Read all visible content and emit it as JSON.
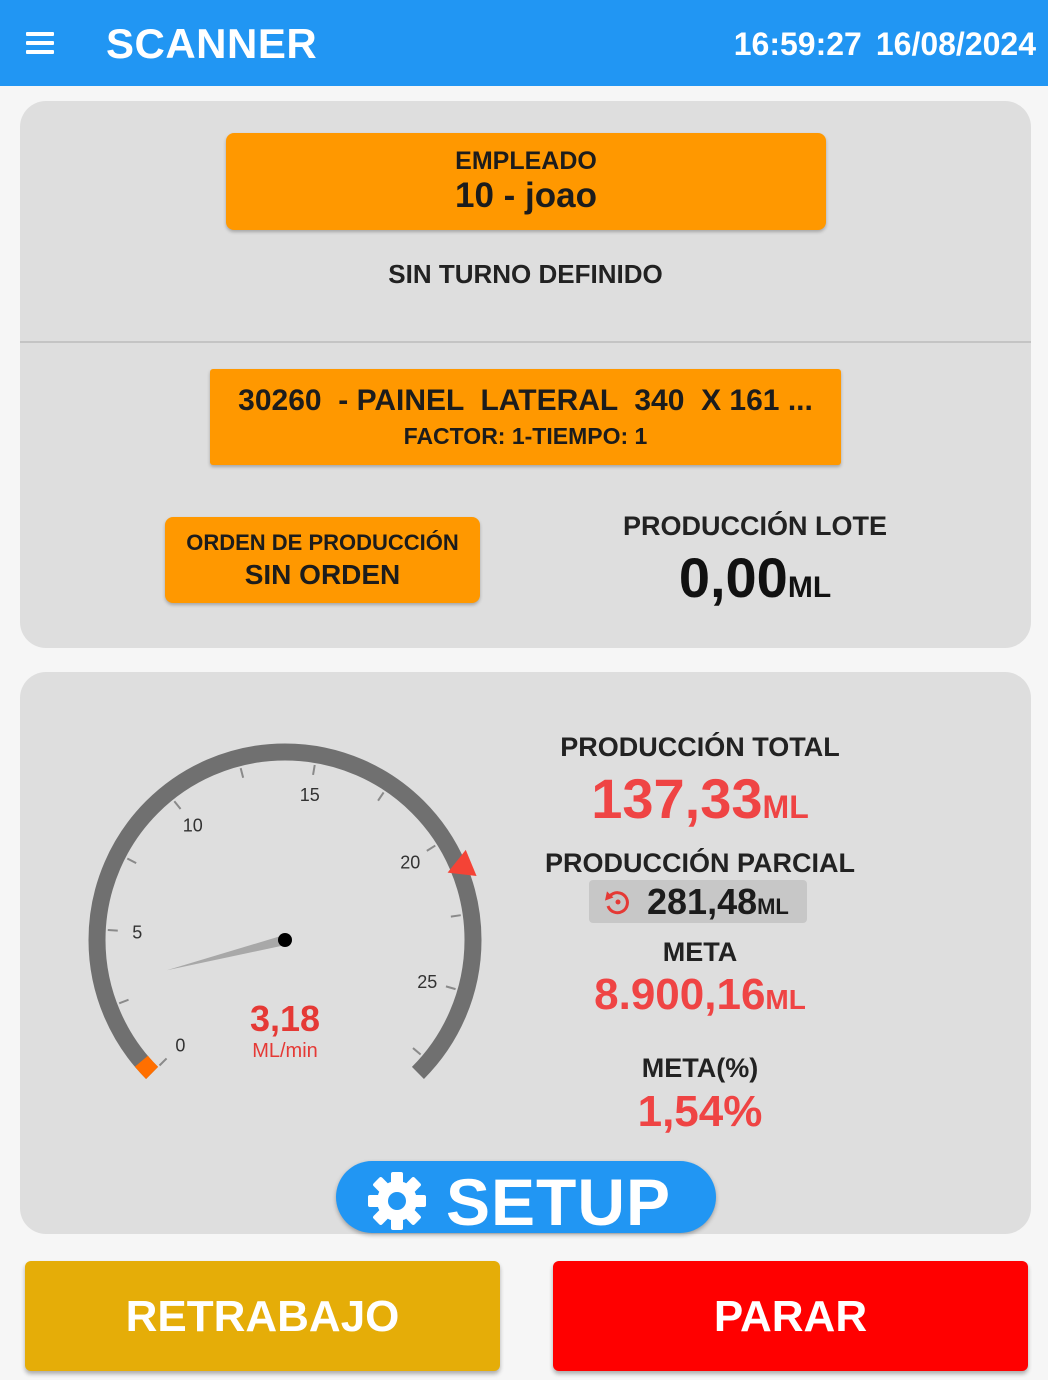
{
  "header": {
    "title": "SCANNER",
    "time": "16:59:27",
    "date": "16/08/2024",
    "menu_icon": "hamburger-menu-icon"
  },
  "employee": {
    "label": "EMPLEADO",
    "value": "10 - joao"
  },
  "shift": "SIN TURNO DEFINIDO",
  "product": {
    "name": "30260  - PAINEL  LATERAL  340  X 161 ...",
    "factor": "FACTOR: 1-TIEMPO: 1"
  },
  "order": {
    "label": "ORDEN DE PRODUCCIÓN",
    "value": "SIN ORDEN"
  },
  "lote": {
    "label": "PRODUCCIÓN LOTE",
    "value": "0,00",
    "unit": "ML"
  },
  "gauge": {
    "value": "3,18",
    "value_number": 3.18,
    "unit": "ML/min",
    "min": 0,
    "max": 28,
    "tick_labels": [
      "0",
      "5",
      "10",
      "15",
      "20",
      "25"
    ],
    "marker_value": 21,
    "colors": {
      "arc": "#707070",
      "needle": "#a8a8a8",
      "marker": "#f44336",
      "start": "#ff6f00"
    }
  },
  "stats": {
    "total_label": "PRODUCCIÓN TOTAL",
    "total_value": "137,33",
    "parcial_label": "PRODUCCIÓN PARCIAL",
    "parcial_value": "281,48",
    "meta_label": "META",
    "meta_value": "8.900,16",
    "metapct_label": "META(%)",
    "metapct_value": "1,54%",
    "unit": "ML",
    "reset_icon": "history-reset-icon"
  },
  "setup": {
    "label": "SETUP",
    "icon": "gear-icon"
  },
  "actions": {
    "rework_label": "RETRABAJO",
    "stop_label": "PARAR"
  },
  "colors": {
    "header": "#2196f3",
    "orange": "#ff9800",
    "red": "#ef4444",
    "rework": "#e5ad08",
    "stop": "#ff0000"
  }
}
